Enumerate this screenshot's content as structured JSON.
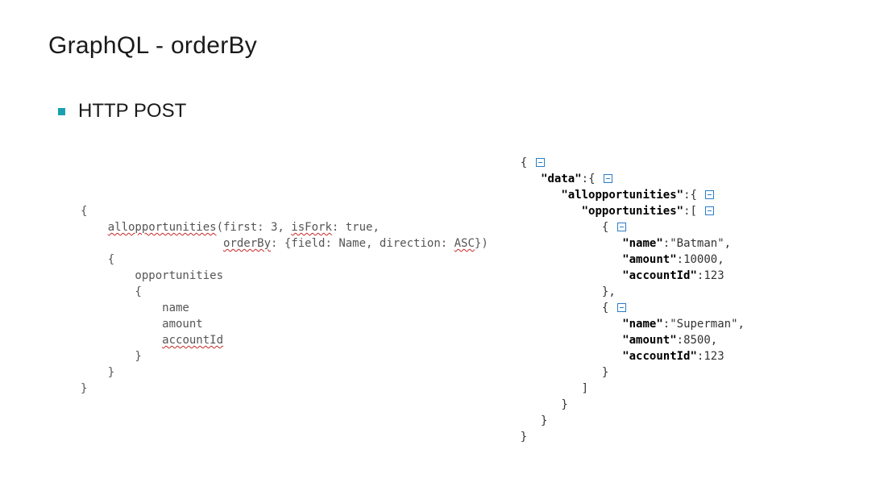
{
  "title": "GraphQL - orderBy",
  "bullet": "HTTP POST",
  "query": {
    "l1": "{",
    "l2a": "    ",
    "l2b": "allopportunities",
    "l2c": "(first: 3, ",
    "l2d": "isFork",
    "l2e": ": true,",
    "l3a": "                     ",
    "l3b": "orderBy",
    "l3c": ": {field: Name, direction: ",
    "l3d": "ASC",
    "l3e": "})",
    "l4": "    {",
    "l5": "        opportunities",
    "l6": "        {",
    "l7": "            name",
    "l8": "            amount",
    "l9a": "            ",
    "l9b": "accountId",
    "l10": "        }",
    "l11": "    }",
    "l12": "}"
  },
  "response": {
    "k_data": "\"data\"",
    "k_allopp": "\"allopportunities\"",
    "k_opp": "\"opportunities\"",
    "k_name": "\"name\"",
    "k_amount": "\"amount\"",
    "k_accountId": "\"accountId\"",
    "v_name1": "\"Batman\"",
    "v_amount1": "10000",
    "v_accountId1": "123",
    "v_name2": "\"Superman\"",
    "v_amount2": "8500",
    "v_accountId2": "123"
  }
}
